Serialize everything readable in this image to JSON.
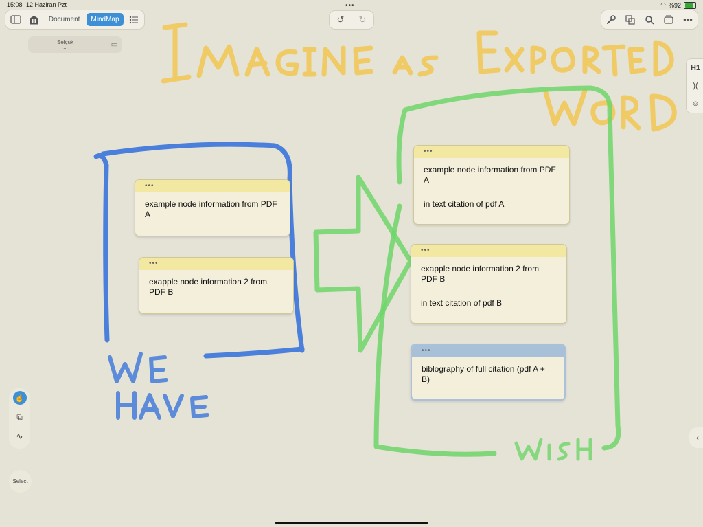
{
  "status": {
    "time": "15:08",
    "date": "12 Haziran Pzt",
    "battery_text": "%92",
    "battery_level": 0.92
  },
  "toolbar": {
    "tabs": [
      {
        "label": "Document",
        "active": false
      },
      {
        "label": "MindMap",
        "active": true
      }
    ],
    "accent_color": "#3d8fd6"
  },
  "person": {
    "name": "Selçuk"
  },
  "side_palette": {
    "heading_label": "H1"
  },
  "left_tools": {
    "select_label": "Select"
  },
  "handwriting": {
    "top": "Imagine as Exported Word",
    "left": "WE HAVE",
    "right": "WISH"
  },
  "nodes_have": [
    {
      "text": "example node information from PDF A"
    },
    {
      "text": "exapple node information 2 from PDF B"
    }
  ],
  "nodes_wish": [
    {
      "text": "example node information from PDF A",
      "citation": "in text citation of pdf A"
    },
    {
      "text": "exapple node information 2 from PDF B",
      "citation": "in text citation of pdf B"
    },
    {
      "text": "biblography of full citation (pdf A + B)"
    }
  ],
  "colors": {
    "background": "#e5e2d6",
    "node_yellow": "#f2e8a2",
    "node_blue": "#a9c0d9",
    "ink_blue": "#2f6fdc",
    "ink_green": "#6fd66a",
    "ink_yellow": "#f3c64a"
  }
}
